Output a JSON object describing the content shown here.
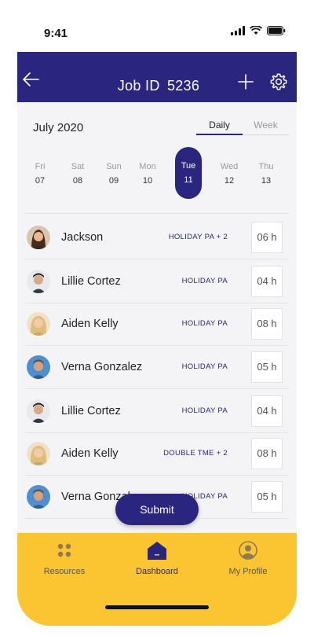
{
  "status": {
    "time": "9:41"
  },
  "header": {
    "title": "Job ID",
    "job_id": "5236"
  },
  "calendar": {
    "month": "July 2020",
    "view_daily": "Daily",
    "view_week": "Week",
    "days": [
      {
        "name": "Fri",
        "date": "07"
      },
      {
        "name": "Sat",
        "date": "08"
      },
      {
        "name": "Sun",
        "date": "09"
      },
      {
        "name": "Mon",
        "date": "10"
      },
      {
        "name": "Tue",
        "date": "11"
      },
      {
        "name": "Wed",
        "date": "12"
      },
      {
        "name": "Thu",
        "date": "13"
      }
    ],
    "selected_index": 4
  },
  "entries": [
    {
      "name": "Jackson",
      "tag": "HOLIDAY PA + 2",
      "hours": "06 h"
    },
    {
      "name": "Lillie Cortez",
      "tag": "HOLIDAY PA",
      "hours": "04 h"
    },
    {
      "name": "Aiden Kelly",
      "tag": "HOLIDAY PA",
      "hours": "08 h"
    },
    {
      "name": "Verna Gonzalez",
      "tag": "HOLIDAY PA",
      "hours": "05 h"
    },
    {
      "name": "Lillie Cortez",
      "tag": "HOLIDAY PA",
      "hours": "04 h"
    },
    {
      "name": "Aiden Kelly",
      "tag": "DOUBLE TME + 2",
      "hours": "08 h"
    },
    {
      "name": "Verna Gonzalez",
      "tag": "HOLIDAY PA",
      "hours": "05 h"
    }
  ],
  "submit_label": "Submit",
  "nav": {
    "resources": "Resources",
    "dashboard": "Dashboard",
    "profile": "My Profile"
  },
  "colors": {
    "brand": "#2a2680",
    "accent": "#fbc531",
    "background": "#f4f4f6"
  }
}
